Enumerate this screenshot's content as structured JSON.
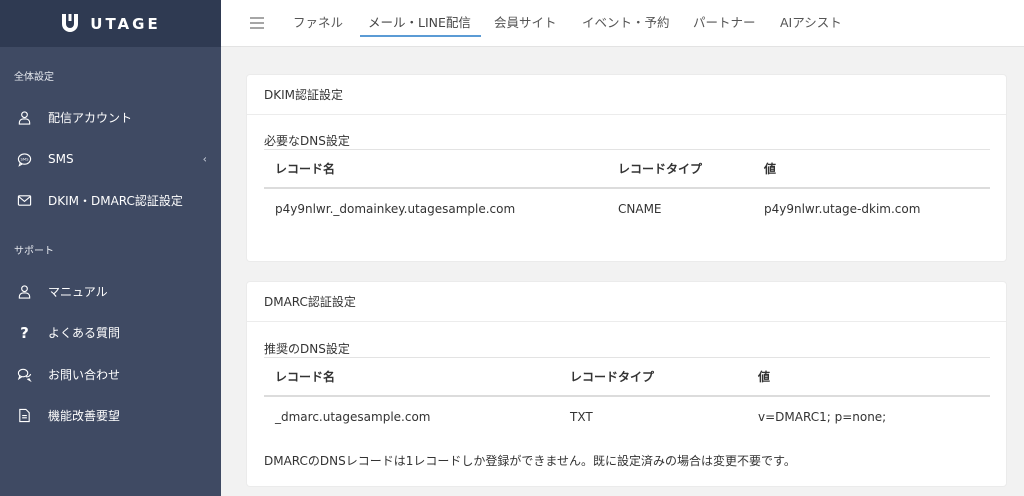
{
  "app": {
    "logo_text": "UTAGE"
  },
  "sidebar": {
    "section1": "全体設定",
    "section2": "サポート",
    "items": [
      {
        "label": "配信アカウント",
        "icon": "user-icon"
      },
      {
        "label": "SMS",
        "icon": "sms-icon",
        "has_chevron": true
      },
      {
        "label": "DKIM・DMARC認証設定",
        "icon": "mail-icon"
      },
      {
        "label": "マニュアル",
        "icon": "user-icon"
      },
      {
        "label": "よくある質問",
        "icon": "question-icon"
      },
      {
        "label": "お問い合わせ",
        "icon": "chat-icon"
      },
      {
        "label": "機能改善要望",
        "icon": "document-icon"
      }
    ],
    "chevron": "‹"
  },
  "topnav": {
    "tabs": [
      {
        "label": "ファネル"
      },
      {
        "label": "メール・LINE配信",
        "active": true
      },
      {
        "label": "会員サイト"
      },
      {
        "label": "イベント・予約"
      },
      {
        "label": "パートナー"
      },
      {
        "label": "AIアシスト"
      }
    ]
  },
  "dkim": {
    "title": "DKIM認証設定",
    "subtitle": "必要なDNS設定",
    "headers": [
      "レコード名",
      "レコードタイプ",
      "値"
    ],
    "rows": [
      [
        "p4y9nlwr._domainkey.utagesample.com",
        "CNAME",
        "p4y9nlwr.utage-dkim.com"
      ]
    ]
  },
  "dmarc": {
    "title": "DMARC認証設定",
    "subtitle": "推奨のDNS設定",
    "headers": [
      "レコード名",
      "レコードタイプ",
      "値"
    ],
    "rows": [
      [
        "_dmarc.utagesample.com",
        "TXT",
        "v=DMARC1; p=none;"
      ]
    ],
    "note": "DMARCのDNSレコードは1レコードしか登録ができません。既に設定済みの場合は変更不要です。"
  },
  "colors": {
    "sidebar_bg": "#3f4a63",
    "logo_bg": "#2f3a52",
    "accent": "#5b9bd5",
    "page_bg": "#f2f2f2"
  }
}
